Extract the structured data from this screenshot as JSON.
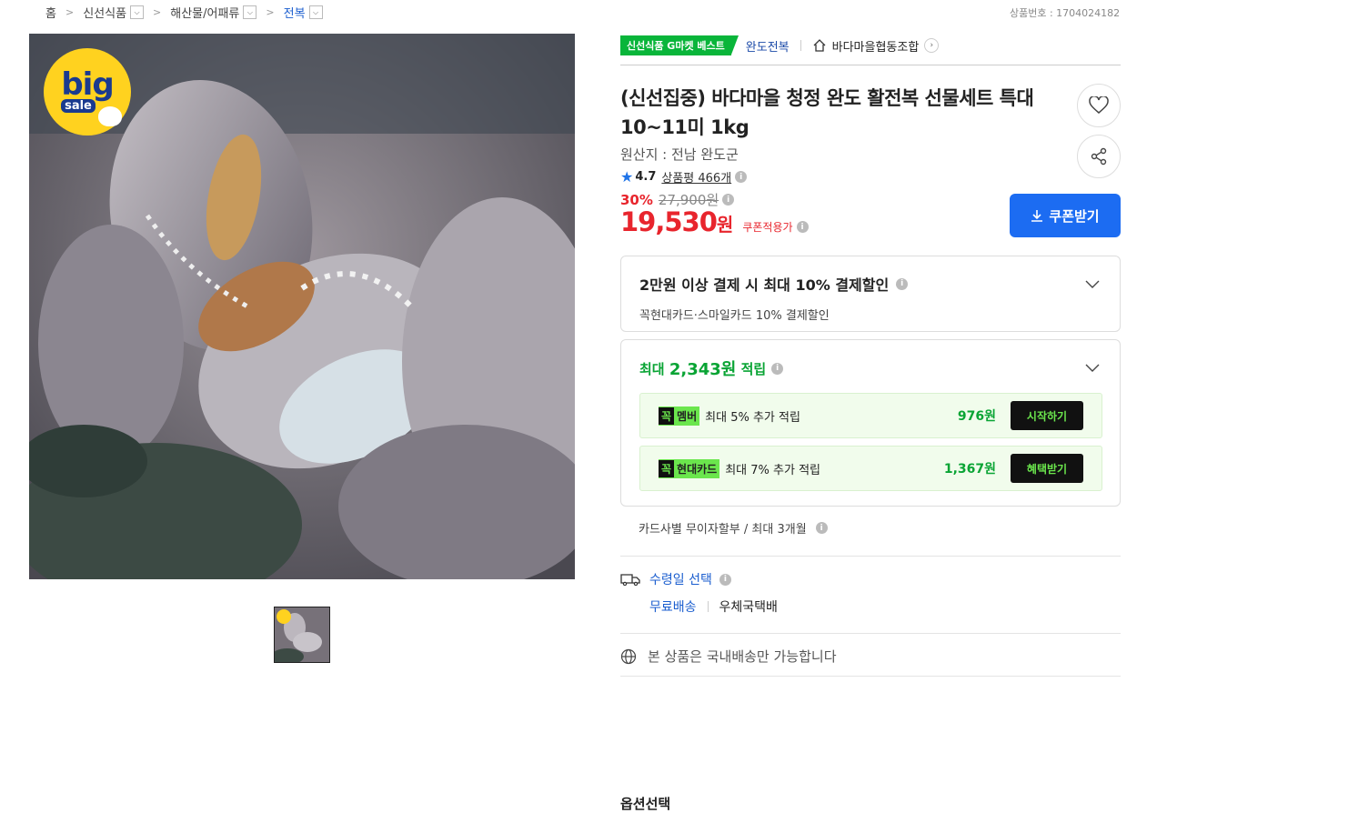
{
  "breadcrumb": {
    "home": "홈",
    "level1": "신선식품",
    "level2": "해산물/어패류",
    "level3": "전복"
  },
  "product_number": "상품번호 : 1704024182",
  "promo_badge": {
    "big": "big",
    "sale": "sale"
  },
  "top": {
    "badge": "신선식품 G마켓 베스트",
    "brand": "완도전복",
    "store": "바다마을협동조합"
  },
  "title": "(신선집중) 바다마을 청정 완도 활전복 선물세트 특대 10~11미 1kg",
  "origin": "원산지 : 전남 완도군",
  "rating": {
    "score": "4.7",
    "review_label": "상품평 466개"
  },
  "discount_pct": "30%",
  "original_price": "27,900원",
  "price": "19,530",
  "price_unit": "원",
  "coupon_price_note": "쿠폰적용가",
  "coupon_button": "쿠폰받기",
  "payment_discount": {
    "title": "2만원 이상 결제 시 최대 10% 결제할인",
    "subtitle": "꼭현대카드·스마일카드 10% 결제할인"
  },
  "points": {
    "prefix": "최대",
    "amount": "2,343원",
    "suffix": "적립",
    "promos": [
      {
        "tag_k": "꼭",
        "tag": "멤버",
        "text": "최대 5% 추가 적립",
        "amount": "976원",
        "button": "시작하기"
      },
      {
        "tag_k": "꼭",
        "tag": "현대카드",
        "text": "최대 7% 추가 적립",
        "amount": "1,367원",
        "button": "혜택받기"
      }
    ]
  },
  "installment": "카드사별 무이자할부 / 최대 3개월",
  "delivery": {
    "select_date": "수령일 선택",
    "free_shipping": "무료배송",
    "carrier": "우체국택배"
  },
  "domestic_only": "본 상품은 국내배송만 가능합니다",
  "option_title": "옵션선택",
  "colors": {
    "accent_blue": "#1c6cf2",
    "price_red": "#e8252d",
    "point_green": "#09a434"
  }
}
